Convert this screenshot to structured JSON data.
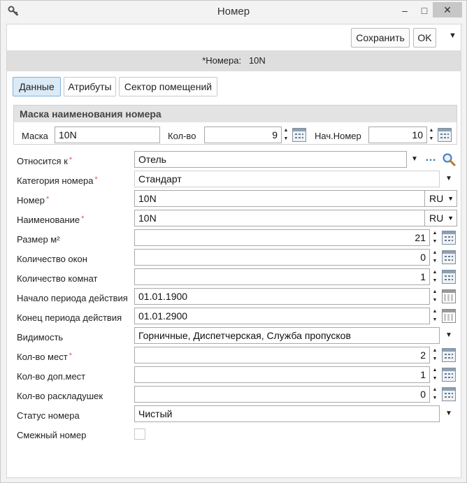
{
  "window": {
    "title": "Номер",
    "minimize": "–",
    "maximize": "□",
    "close": "✕"
  },
  "toolbar": {
    "save_label": "Сохранить",
    "ok_label": "OK",
    "menu_caret": "▼"
  },
  "record": {
    "label": "*Номера:",
    "value": "10N"
  },
  "tabs": [
    {
      "label": "Данные",
      "active": true
    },
    {
      "label": "Атрибуты",
      "active": false
    },
    {
      "label": "Сектор помещений",
      "active": false
    }
  ],
  "mask": {
    "title": "Маска наименования номера",
    "mask_label": "Маска",
    "mask_value": "10N",
    "count_label": "Кол-во",
    "count_value": "9",
    "start_label": "Нач.Номер",
    "start_value": "10"
  },
  "fields": {
    "belongs_to": {
      "label": "Относится к",
      "required": "*",
      "value": "Отель"
    },
    "category": {
      "label": "Категория номера",
      "required": "*",
      "value": "Стандарт"
    },
    "number": {
      "label": "Номер",
      "required": "*",
      "value": "10N",
      "lang": "RU"
    },
    "name": {
      "label": "Наименование",
      "required": "*",
      "value": "10N",
      "lang": "RU"
    },
    "size": {
      "label": "Размер м²",
      "value": "21"
    },
    "windows": {
      "label": "Количество окон",
      "value": "0"
    },
    "rooms": {
      "label": "Количество комнат",
      "value": "1"
    },
    "period_start": {
      "label": "Начало периода действия",
      "value": "01.01.1900"
    },
    "period_end": {
      "label": "Конец периода действия",
      "value": "01.01.2900"
    },
    "visibility": {
      "label": "Видимость",
      "value": "Горничные, Диспетчерская, Служба пропусков"
    },
    "places": {
      "label": "Кол-во мест",
      "required": "*",
      "value": "2"
    },
    "extra_places": {
      "label": "Кол-во доп.мест",
      "value": "1"
    },
    "cots": {
      "label": "Кол-во раскладушек",
      "value": "0"
    },
    "status": {
      "label": "Статус номера",
      "value": "Чистый"
    },
    "adjacent": {
      "label": "Смежный номер",
      "checked": false
    }
  },
  "icons": {
    "app": "key-icon",
    "lookup_dots": "…",
    "search": "search-icon",
    "calculator": "calculator-icon",
    "calendar": "calendar-icon"
  },
  "colors": {
    "active_tab_bg": "#daeaf7",
    "active_tab_border": "#7fb2da",
    "required_mark": "#e0544f",
    "record_bar": "#dedede",
    "link_blue": "#2f7fc3"
  }
}
